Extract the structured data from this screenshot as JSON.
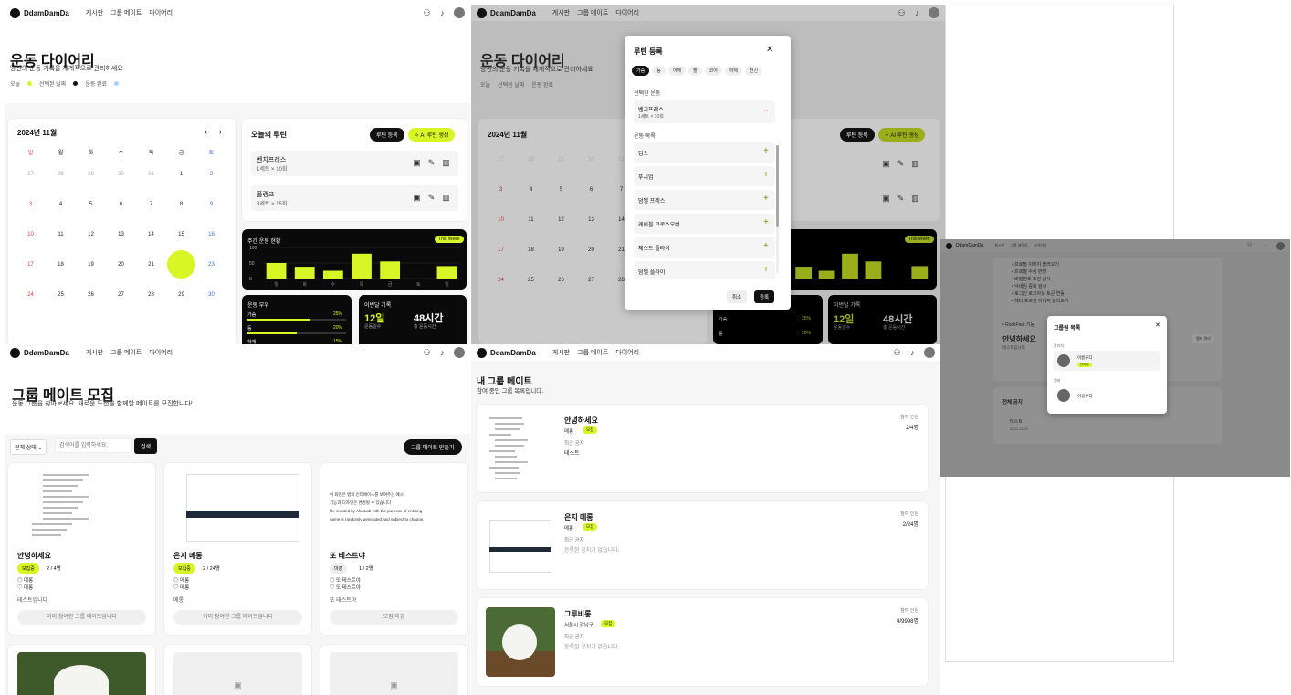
{
  "brand": "DdamDamDa",
  "nav": [
    "게시판",
    "그룹 메이트",
    "다이어리"
  ],
  "diary": {
    "title": "운동 다이어리",
    "subtitle": "당신의 운동 기록을 체계적으로 관리하세요",
    "legend": [
      "오늘",
      "선택된 날짜",
      "운동 완료"
    ],
    "month": "2024년 11월",
    "weekdays": [
      "일",
      "월",
      "화",
      "수",
      "목",
      "금",
      "토"
    ],
    "weeks": [
      [
        "27",
        "28",
        "29",
        "30",
        "31",
        "1",
        "2"
      ],
      [
        "3",
        "4",
        "5",
        "6",
        "7",
        "8",
        "9"
      ],
      [
        "10",
        "11",
        "12",
        "13",
        "14",
        "15",
        "16"
      ],
      [
        "17",
        "18",
        "19",
        "20",
        "21",
        "22",
        "23"
      ],
      [
        "24",
        "25",
        "26",
        "27",
        "28",
        "29",
        "30"
      ]
    ],
    "selected_day": "22",
    "routine_title": "오늘의 루틴",
    "routine_add": "루틴 등록",
    "ai_routine": "✧ AI 루틴 생성",
    "routines": [
      {
        "name": "벤치프레스",
        "detail": "1세트 × 10회"
      },
      {
        "name": "플랭크",
        "detail": "3세트 × 15회"
      }
    ],
    "weekly_title": "주간 운동 현황",
    "weekly_badge": "This Week",
    "weekly_yticks": [
      "100",
      "50",
      "0"
    ],
    "weekly_days": [
      "월",
      "화",
      "수",
      "목",
      "금",
      "토",
      "일"
    ],
    "weekly_values": [
      50,
      38,
      25,
      80,
      55,
      0,
      40
    ],
    "parts_title": "운동 부위",
    "parts": [
      {
        "name": "가슴",
        "pct": "25%",
        "value": 25
      },
      {
        "name": "등",
        "pct": "20%",
        "value": 20
      },
      {
        "name": "하체",
        "pct": "15%",
        "value": 15
      }
    ],
    "month_title": "이번달 기록",
    "month_days": "12일",
    "month_days_label": "운동일수",
    "month_hours": "48시간",
    "month_hours_label": "총 운동시간"
  },
  "modal": {
    "title": "루틴 등록",
    "tabs": [
      "가슴",
      "등",
      "어깨",
      "팔",
      "코어",
      "하체",
      "전신"
    ],
    "selected_label": "선택된 운동",
    "selected": {
      "name": "벤치프레스",
      "detail": "1세트 × 10회"
    },
    "list_label": "운동 목록",
    "exercises": [
      "딥스",
      "푸시업",
      "덤벨 프레스",
      "케이블 크로스오버",
      "체스트 플라이",
      "덤벨 플라이"
    ],
    "cancel": "취소",
    "submit": "등록"
  },
  "members_modal": {
    "title": "그룹원 목록",
    "leader_label": "관리자",
    "leader_name": "이름투디",
    "leader_badge": "관리자",
    "member_label": "멤버",
    "member_name": "이름투디",
    "bg_list": [
      "프로필 이미지 불러오기",
      "프로필 수정 반영",
      "비밀번호 조건 검사",
      "닉네임 중복 검사",
      "로그인 로그아웃 토큰 연동",
      "헤더 프로필 이미지 불러오기"
    ],
    "bg_bullet": "RockFnut 기능",
    "bg_card_title": "안녕하세요",
    "bg_card_sub": "테스트입니다",
    "bg_notice_title": "전체 공지",
    "bg_notice": "테스트",
    "bg_notice_date": "2024.11.20",
    "bg_btn": "멤버 관리"
  },
  "mates": {
    "title": "그룹 메이트 모집",
    "subtitle": "운동 그룹을 찾아보세요. 새로운 도전을 함께할 메이트를 모집합니다!",
    "filter": "전체 상태",
    "search_placeholder": "검색어를 입력하세요.",
    "search_btn": "검색",
    "create_btn": "그룹 메이트 만들기",
    "cards": [
      {
        "title": "안녕하세요",
        "status": "모집중",
        "count": "2 / 4명",
        "loc": "◎ 메롱",
        "tag": "♡ 메롱",
        "desc": "테스트입니다",
        "action": "이미 참여한 그룹 메이트입니다"
      },
      {
        "title": "은지 메롱",
        "status": "모집중",
        "count": "2 / 24명",
        "loc": "◎ 메롱",
        "tag": "♡ 메롱",
        "desc": "메롱",
        "action": "이미 참여한 그룹 메이트입니다"
      },
      {
        "title": "또 테스트야",
        "status": "마감",
        "count": "1 / 2명",
        "loc": "◎ 또 테스트야",
        "tag": "♡ 또 테스트야",
        "desc": "또 테스트야",
        "action": "모집 마감"
      }
    ],
    "preview_text": [
      "이 화면은 앱의 인터페이스를 보여주는 예시",
      "기능과 디자인은 변경될 수 있습니다",
      "file created by AlexLab with the purpose of enticing",
      "name is randomly generated and subject to change."
    ]
  },
  "mygroups": {
    "title": "내 그룹 메이트",
    "subtitle": "참여 중인 그룹 목록입니다.",
    "members_label": "참여 인원",
    "notice_label": "최근 공지",
    "groups": [
      {
        "name": "안녕하세요",
        "place": "메롱",
        "status": "모집",
        "count": "2/4명",
        "notice": "테스트"
      },
      {
        "name": "은지 메롱",
        "place": "메롱",
        "status": "모집",
        "count": "2/24명",
        "notice": "등록된 공지가 없습니다."
      },
      {
        "name": "그루비롱",
        "place": "서울시 강남구",
        "status": "모집",
        "count": "4/9998명",
        "notice": "등록된 공지가 없습니다."
      }
    ]
  },
  "colors": {
    "accent": "#d8f526",
    "dark": "#0a0a0a",
    "danger": "#e53935",
    "sunday": "#e53935",
    "saturday": "#3b6fd6"
  }
}
